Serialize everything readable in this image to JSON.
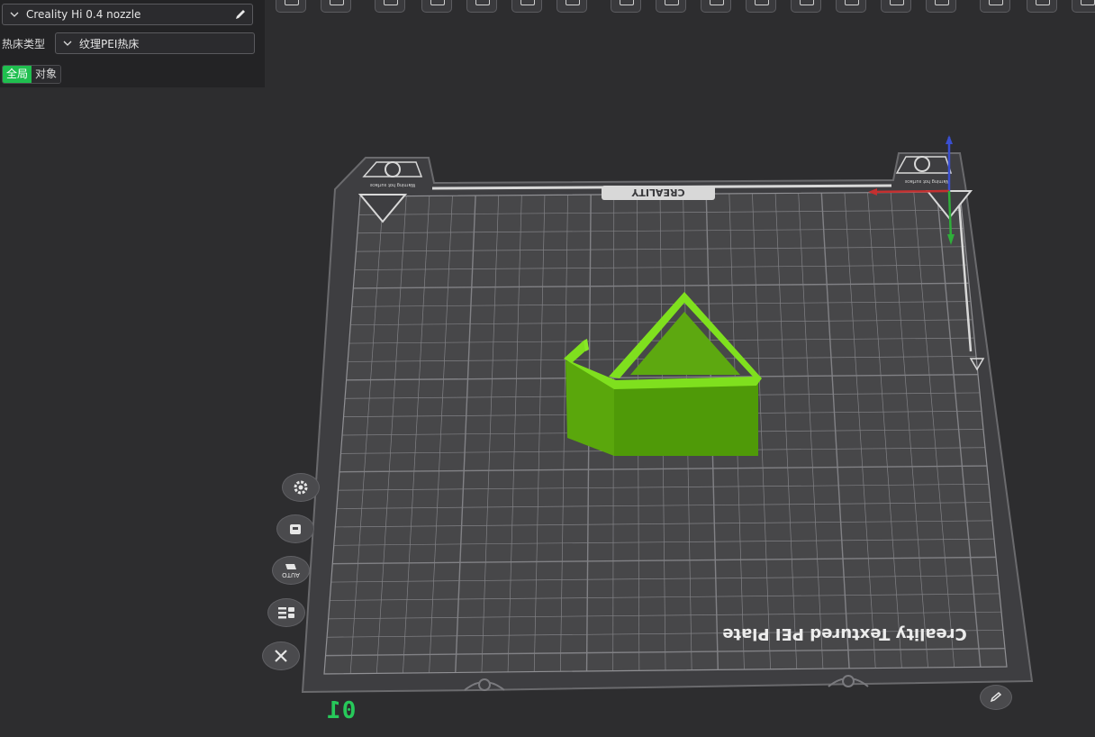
{
  "panel": {
    "printer_select": "Creality Hi 0.4 nozzle",
    "bed_type_label": "热床类型",
    "bed_type_select": "纹理PEI热床",
    "scope_global": "全局",
    "scope_object": "对象"
  },
  "plate": {
    "brand_text": "CREALITY",
    "plate_caption": "Creality Textured PEI Plate",
    "warning_text": "Warning hot surface",
    "plate_number": "01",
    "auto_label": "AUTO"
  },
  "colors": {
    "accent_green": "#1fbf4f",
    "model_green": "#5fb30f",
    "axis_x": "#c43030",
    "axis_y": "#2fae3a",
    "axis_z": "#3a4fd0"
  },
  "side_buttons": [
    "settings-icon",
    "plate-lock-icon",
    "auto-arrange-icon",
    "layout-icon",
    "close-icon"
  ]
}
